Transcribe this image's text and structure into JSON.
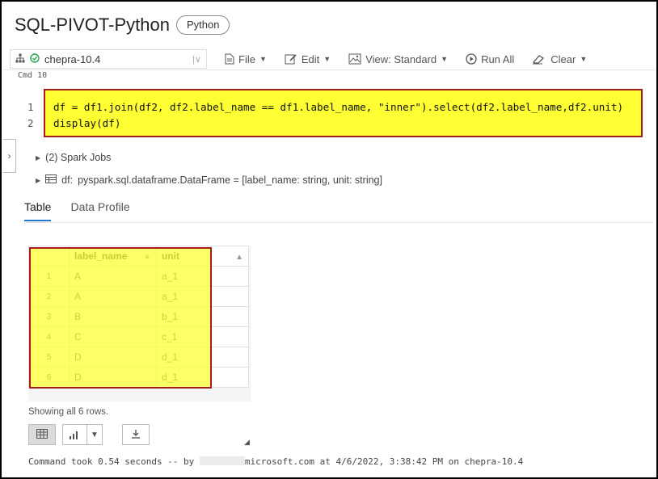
{
  "notebook": {
    "title": "SQL-PIVOT-Python",
    "language": "Python"
  },
  "toolbar": {
    "cluster": "chepra-10.4",
    "file": "File",
    "edit": "Edit",
    "view": "View: Standard",
    "run_all": "Run All",
    "clear": "Clear"
  },
  "cell": {
    "label": "Cmd 10",
    "lines": [
      {
        "num": "1",
        "code": "df = df1.join(df2, df2.label_name == df1.label_name, \"inner\").select(df2.label_name,df2.unit)"
      },
      {
        "num": "2",
        "code": "display(df)"
      }
    ]
  },
  "output": {
    "spark_jobs": "(2) Spark Jobs",
    "df_prefix": "df:",
    "df_type": "pyspark.sql.dataframe.DataFrame = [label_name: string, unit: string]",
    "tabs": [
      "Table",
      "Data Profile"
    ],
    "table": {
      "headers": [
        "label_name",
        "unit"
      ],
      "rows": [
        [
          "1",
          "A",
          "a_1"
        ],
        [
          "2",
          "A",
          "a_1"
        ],
        [
          "3",
          "B",
          "b_1"
        ],
        [
          "4",
          "C",
          "c_1"
        ],
        [
          "5",
          "D",
          "d_1"
        ],
        [
          "6",
          "D",
          "d_1"
        ]
      ]
    },
    "showing": "Showing all 6 rows.",
    "footer_prefix": "Command took 0.54 seconds -- by ",
    "footer_suffix": "microsoft.com at 4/6/2022, 3:38:42 PM on chepra-10.4"
  },
  "colors": {
    "highlight": "#ffff33",
    "highlight_border": "#a51c1c",
    "tab_accent": "#1f77d4"
  }
}
